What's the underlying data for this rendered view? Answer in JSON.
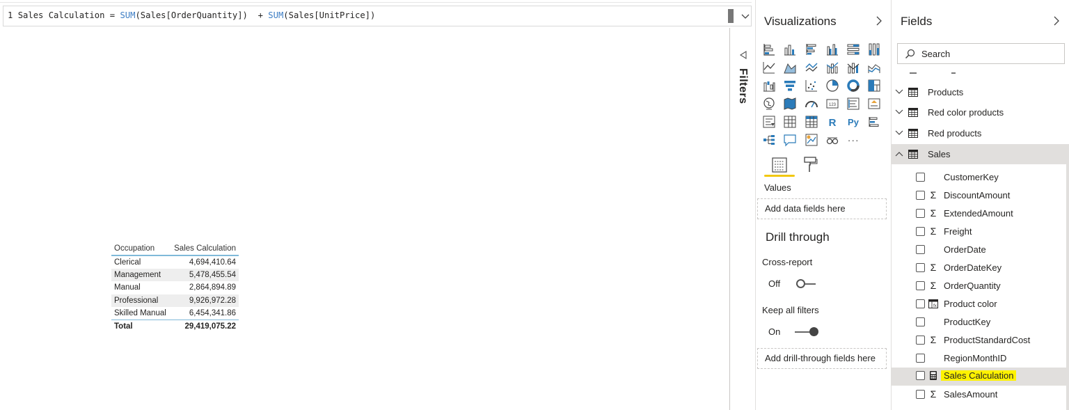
{
  "formula_bar": {
    "line_number": "1",
    "measure_name": "Sales Calculation",
    "eq": " = ",
    "fn1": "SUM",
    "arg1": "(Sales[OrderQuantity])",
    "plus": "  + ",
    "fn2": "SUM",
    "arg2": "(Sales[UnitPrice])"
  },
  "table_visual": {
    "columns": [
      "Occupation",
      "Sales Calculation"
    ],
    "rows": [
      {
        "occupation": "Clerical",
        "value": "4,694,410.64"
      },
      {
        "occupation": "Management",
        "value": "5,478,455.54"
      },
      {
        "occupation": "Manual",
        "value": "2,864,894.89"
      },
      {
        "occupation": "Professional",
        "value": "9,926,972.28"
      },
      {
        "occupation": "Skilled Manual",
        "value": "6,454,341.86"
      }
    ],
    "total_label": "Total",
    "total_value": "29,419,075.22"
  },
  "filters_pane": {
    "label": "Filters"
  },
  "visualizations": {
    "title": "Visualizations",
    "icons": [
      "stacked-bar-chart-icon",
      "stacked-column-chart-icon",
      "clustered-bar-chart-icon",
      "clustered-column-chart-icon",
      "100-stacked-bar-chart-icon",
      "100-stacked-column-chart-icon",
      "line-chart-icon",
      "area-chart-icon",
      "stacked-area-chart-icon",
      "line-clustered-column-icon",
      "line-stacked-column-icon",
      "ribbon-chart-icon",
      "waterfall-chart-icon",
      "funnel-icon",
      "scatter-chart-icon",
      "pie-chart-icon",
      "donut-chart-icon",
      "treemap-icon",
      "map-icon",
      "filled-map-icon",
      "gauge-icon",
      "card-icon",
      "multi-row-card-icon",
      "kpi-icon",
      "slicer-icon",
      "table-icon",
      "matrix-icon",
      "r-visual-icon",
      "python-visual-icon",
      "key-influencers-icon",
      "decomposition-tree-icon",
      "qa-icon",
      "smart-narrative-icon",
      "paginated-report-icon",
      "more-visuals-icon"
    ],
    "r_label": "R",
    "py_label": "Py",
    "more_label": "···",
    "values_label": "Values",
    "values_placeholder": "Add data fields here",
    "drill_title": "Drill through",
    "cross_report_label": "Cross-report",
    "cross_report_state": "Off",
    "keep_filters_label": "Keep all filters",
    "keep_filters_state": "On",
    "drill_placeholder": "Add drill-through fields here"
  },
  "fields": {
    "title": "Fields",
    "search_placeholder": "Search",
    "tables": [
      {
        "name": "Products",
        "expanded": false
      },
      {
        "name": "Red color products",
        "expanded": false
      },
      {
        "name": "Red products",
        "expanded": false
      },
      {
        "name": "Sales",
        "expanded": true
      }
    ],
    "sales_fields": [
      {
        "name": "CustomerKey",
        "icon": ""
      },
      {
        "name": "DiscountAmount",
        "icon": "Σ"
      },
      {
        "name": "ExtendedAmount",
        "icon": "Σ"
      },
      {
        "name": "Freight",
        "icon": "Σ"
      },
      {
        "name": "OrderDate",
        "icon": ""
      },
      {
        "name": "OrderDateKey",
        "icon": "Σ"
      },
      {
        "name": "OrderQuantity",
        "icon": "Σ"
      },
      {
        "name": "Product color",
        "icon": "calculated-column"
      },
      {
        "name": "ProductKey",
        "icon": ""
      },
      {
        "name": "ProductStandardCost",
        "icon": "Σ"
      },
      {
        "name": "RegionMonthID",
        "icon": ""
      },
      {
        "name": "Sales Calculation",
        "icon": "measure"
      },
      {
        "name": "SalesAmount",
        "icon": "Σ"
      }
    ],
    "highlight_color": "#fff200"
  }
}
